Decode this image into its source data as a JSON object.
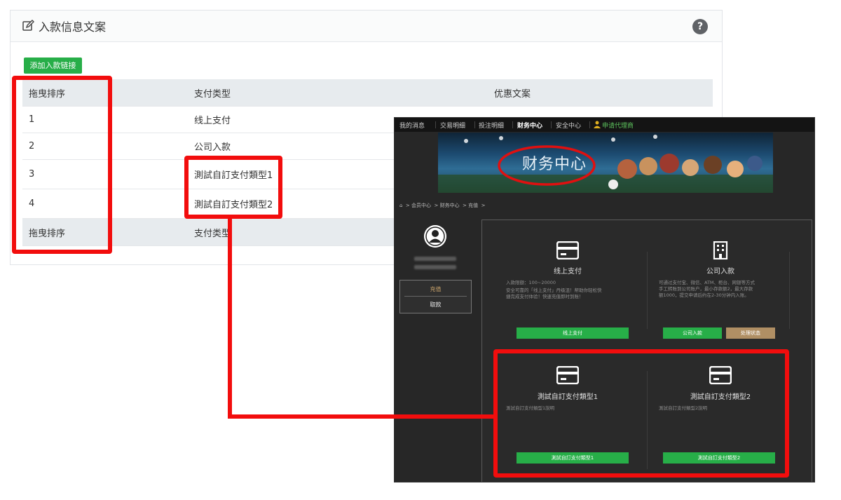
{
  "panel": {
    "title": "入款信息文案",
    "help_label": "?",
    "add_button": "添加入款链接",
    "table": {
      "headers": [
        "拖曳排序",
        "支付类型",
        "优惠文案"
      ],
      "rows": [
        {
          "order": "1",
          "type": "线上支付"
        },
        {
          "order": "2",
          "type": "公司入款"
        },
        {
          "order": "3",
          "type": "測試自訂支付類型1"
        },
        {
          "order": "4",
          "type": "測試自訂支付類型2"
        }
      ],
      "footer": [
        "拖曳排序",
        "支付类型"
      ]
    }
  },
  "site": {
    "nav": [
      "我的消息",
      "交易明细",
      "投注明细",
      "财务中心",
      "安全中心",
      "申请代理商"
    ],
    "banner_title": "财务中心",
    "breadcrumb": [
      "会员中心",
      "财务中心",
      "充值"
    ],
    "sidebar": {
      "menu": [
        "充值",
        "取款"
      ]
    },
    "cards": [
      {
        "title": "线上支付",
        "desc_line1": "入款限额：100~20000",
        "desc_line2": "安全可靠的「线上支付」丹级沮！帮助你轻松快",
        "desc_line3": "捷完成支付体验！快速充值即时到账！",
        "buttons": [
          "线上支付"
        ]
      },
      {
        "title": "公司入款",
        "desc_line1": "可通过支付宝、微信、ATM、柜台、网银等方式",
        "desc_line2": "手工转账到公司账户，最小存款额2，最大存款",
        "desc_line3": "额1000，提交申请后约在2-30分钟内入账。",
        "buttons": [
          "公司入款",
          "处理状态"
        ]
      },
      {
        "title": "測試自訂支付類型1",
        "desc_line1": "測試自訂支付類型1說明",
        "buttons": [
          "測試自訂支付類型1"
        ]
      },
      {
        "title": "測試自訂支付類型2",
        "desc_line1": "測試自訂支付類型2說明",
        "buttons": [
          "測試自訂支付類型2"
        ]
      }
    ]
  },
  "colors": {
    "accent_green": "#27ae48",
    "annotation_red": "#f20d0d",
    "site_bg": "#272727",
    "tan_button": "#b08f64"
  },
  "icons": [
    "edit-icon",
    "help-icon",
    "home-icon",
    "user-icon",
    "card-icon",
    "building-icon"
  ]
}
